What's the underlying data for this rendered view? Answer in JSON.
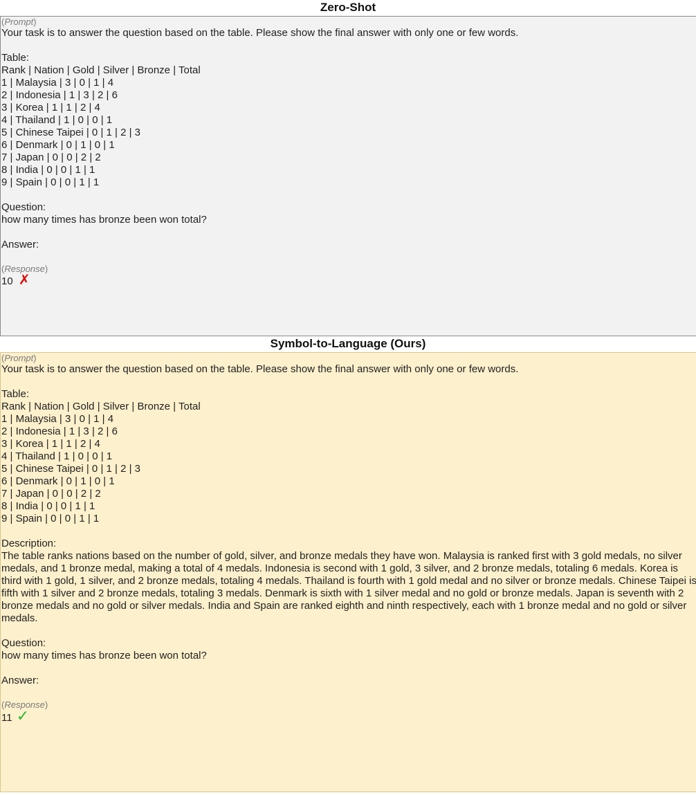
{
  "zero_shot": {
    "title": "Zero-Shot",
    "prompt_tag": "Prompt",
    "instruction": "Your task is to answer the question based on the table. Please show the final answer with only one or few words.",
    "table_label": "Table:",
    "table_rows": [
      "Rank | Nation | Gold | Silver | Bronze | Total",
      "1 | Malaysia | 3 | 0 | 1 | 4",
      "2 | Indonesia | 1 | 3 | 2 | 6",
      "3 | Korea | 1 | 1 | 2 | 4",
      "4 | Thailand | 1 | 0 | 0 | 1",
      "5 | Chinese Taipei | 0 | 1 | 2 | 3",
      "6 | Denmark | 0 | 1 | 0 | 1",
      "7 | Japan | 0 | 0 | 2 | 2",
      "8 | India | 0 | 0 | 1 | 1",
      "9 | Spain | 0 | 0 | 1 | 1"
    ],
    "question_label": "Question:",
    "question": "how many times has bronze been won total?",
    "answer_label": "Answer:",
    "response_tag": "Response",
    "response": "10",
    "mark": "✗"
  },
  "ours": {
    "title": "Symbol-to-Language (Ours)",
    "prompt_tag": "Prompt",
    "instruction": "Your task is to answer the question based on the table. Please show the final answer with only one or few words.",
    "table_label": "Table:",
    "table_rows": [
      "Rank | Nation | Gold | Silver | Bronze | Total",
      "1 | Malaysia | 3 | 0 | 1 | 4",
      "2 | Indonesia | 1 | 3 | 2 | 6",
      "3 | Korea | 1 | 1 | 2 | 4",
      "4 | Thailand | 1 | 0 | 0 | 1",
      "5 | Chinese Taipei | 0 | 1 | 2 | 3",
      "6 | Denmark | 0 | 1 | 0 | 1",
      "7 | Japan | 0 | 0 | 2 | 2",
      "8 | India | 0 | 0 | 1 | 1",
      "9 | Spain | 0 | 0 | 1 | 1"
    ],
    "description_label": "Description:",
    "description": "The table ranks nations based on the number of gold, silver, and bronze medals they have won. Malaysia is ranked first with 3 gold medals, no silver medals, and 1 bronze medal, making a total of 4 medals. Indonesia is second with 1 gold, 3 silver, and 2 bronze medals, totaling 6 medals. Korea is third with 1 gold, 1 silver, and 2 bronze medals, totaling 4 medals. Thailand is fourth with 1 gold medal and no silver or bronze medals. Chinese Taipei is fifth with 1 silver and 2 bronze medals, totaling 3 medals. Denmark is sixth with 1 silver medal and no gold or bronze medals. Japan is seventh with 2 bronze medals and no gold or silver medals. India and Spain are ranked eighth and ninth respectively, each with 1 bronze medal and no gold or silver medals.",
    "question_label": "Question:",
    "question": "how many times has bronze been won total?",
    "answer_label": "Answer:",
    "response_tag": "Response",
    "response": "11",
    "mark": "✓"
  },
  "colors": {
    "zero_bg": "#f2f2f2",
    "ours_bg": "#fdf0cc",
    "wrong": "#e00000",
    "right": "#2fb52f"
  }
}
